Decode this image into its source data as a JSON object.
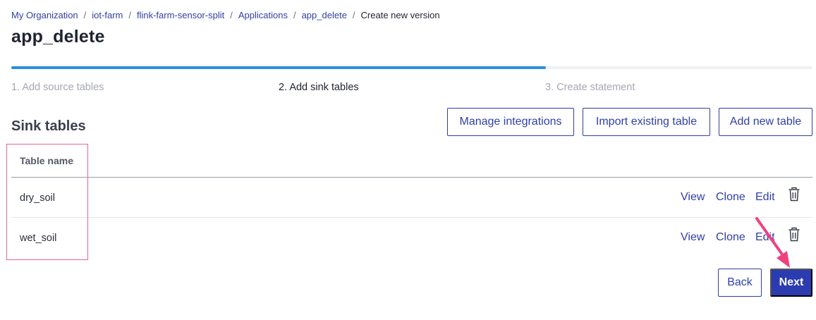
{
  "breadcrumb": {
    "items": [
      "My Organization",
      "iot-farm",
      "flink-farm-sensor-split",
      "Applications",
      "app_delete"
    ],
    "current": "Create new version",
    "separator": "/"
  },
  "page": {
    "title": "app_delete"
  },
  "steps": {
    "progress_fraction": 0.667,
    "items": [
      "1. Add source tables",
      "2. Add sink tables",
      "3. Create statement"
    ],
    "active_index": 1
  },
  "section": {
    "title": "Sink tables"
  },
  "toolbar": {
    "manage_label": "Manage integrations",
    "import_label": "Import existing table",
    "add_label": "Add new table"
  },
  "table": {
    "column_header": "Table name",
    "rows": [
      {
        "name": "dry_soil",
        "view": "View",
        "clone": "Clone",
        "edit": "Edit",
        "delete_icon": "trash-icon"
      },
      {
        "name": "wet_soil",
        "view": "View",
        "clone": "Clone",
        "edit": "Edit",
        "delete_icon": "trash-icon"
      }
    ]
  },
  "footer": {
    "back_label": "Back",
    "next_label": "Next"
  },
  "colors": {
    "accent": "#2f3fa8",
    "primary_button": "#2b3bb0",
    "progress": "#2b8fe0",
    "annotation": "#f06292"
  }
}
